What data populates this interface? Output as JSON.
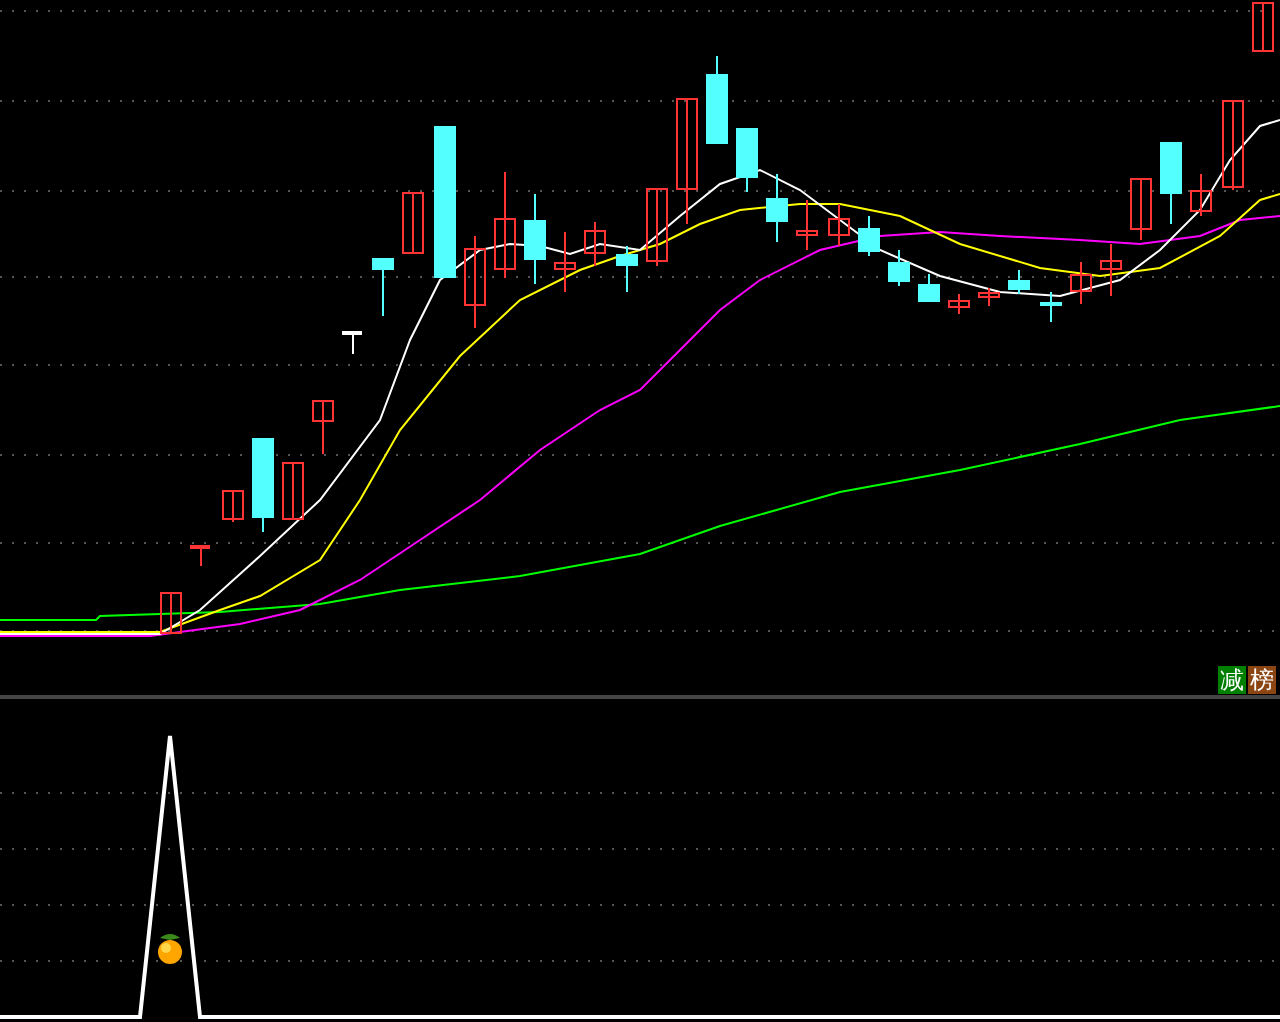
{
  "signals": [
    {
      "text": "减",
      "color": "#008000"
    },
    {
      "text": "榜",
      "color": "#8b4513"
    }
  ]
}
